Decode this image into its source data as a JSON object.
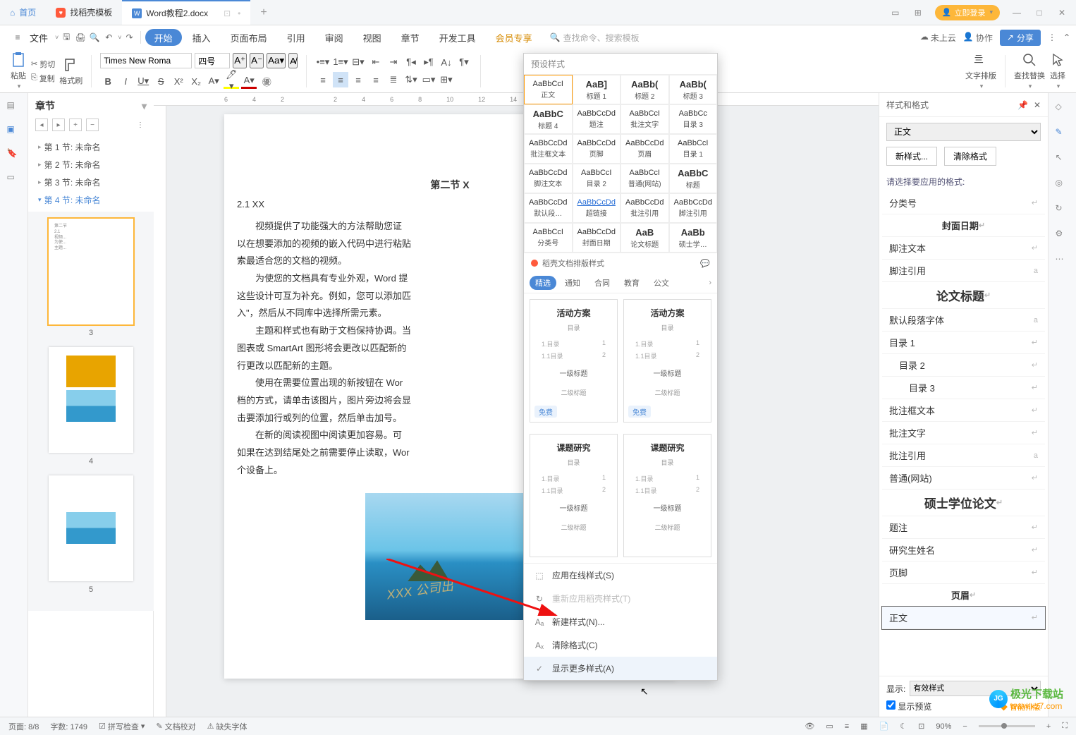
{
  "titlebar": {
    "tabs": [
      {
        "label": "首页",
        "icon": "home"
      },
      {
        "label": "找稻壳模板",
        "icon": "docer"
      },
      {
        "label": "Word教程2.docx",
        "icon": "word",
        "active": true
      }
    ],
    "login": "立即登录"
  },
  "menubar": {
    "file": "文件",
    "tabs": [
      "开始",
      "插入",
      "页面布局",
      "引用",
      "审阅",
      "视图",
      "章节",
      "开发工具",
      "会员专享"
    ],
    "active": "开始",
    "search_placeholder": "查找命令、搜索模板",
    "cloud": "未上云",
    "coop": "协作",
    "share": "分享"
  },
  "ribbon": {
    "paste": "粘贴",
    "cut": "剪切",
    "copy": "复制",
    "format_painter": "格式刷",
    "font_name": "Times New Roma",
    "font_size": "四号",
    "text_layout": "文字排版",
    "find_replace": "查找替换",
    "select": "选择",
    "styles_header": "预设样式"
  },
  "style_grid": [
    {
      "prev": "AaBbCcI",
      "lbl": "正文",
      "sel": true
    },
    {
      "prev": "AaB]",
      "lbl": "标题 1",
      "bold": true
    },
    {
      "prev": "AaBb(",
      "lbl": "标题 2",
      "bold": true
    },
    {
      "prev": "AaBb(",
      "lbl": "标题 3",
      "bold": true
    },
    {
      "prev": "AaBbC",
      "lbl": "标题 4",
      "bold": true
    },
    {
      "prev": "AaBbCcDd",
      "lbl": "题注"
    },
    {
      "prev": "AaBbCcI",
      "lbl": "批注文字"
    },
    {
      "prev": "AaBbCc",
      "lbl": "目录 3"
    },
    {
      "prev": "AaBbCcDd",
      "lbl": "批注框文本"
    },
    {
      "prev": "AaBbCcDd",
      "lbl": "页脚"
    },
    {
      "prev": "AaBbCcDd",
      "lbl": "页眉"
    },
    {
      "prev": "AaBbCcI",
      "lbl": "目录 1"
    },
    {
      "prev": "AaBbCcDd",
      "lbl": "脚注文本"
    },
    {
      "prev": "AaBbCcI",
      "lbl": "目录 2"
    },
    {
      "prev": "AaBbCcI",
      "lbl": "普通(网站)"
    },
    {
      "prev": "AaBbC",
      "lbl": "标题",
      "bold": true
    },
    {
      "prev": "AaBbCcDd",
      "lbl": "默认段…"
    },
    {
      "prev": "AaBbCcDd",
      "lbl": "超链接",
      "link": true
    },
    {
      "prev": "AaBbCcDd",
      "lbl": "批注引用"
    },
    {
      "prev": "AaBbCcDd",
      "lbl": "脚注引用"
    },
    {
      "prev": "AaBbCcI",
      "lbl": "分类号"
    },
    {
      "prev": "AaBbCcDd",
      "lbl": "封面日期"
    },
    {
      "prev": "AaB",
      "lbl": "论文标题",
      "bold": true
    },
    {
      "prev": "AaBb",
      "lbl": "硕士学…",
      "bold": true
    }
  ],
  "docer_head": "稻壳文档排版样式",
  "docer_tabs": [
    "精选",
    "通知",
    "合同",
    "教育",
    "公文"
  ],
  "templates": [
    {
      "title": "活动方案",
      "sub": "目录",
      "lines": [
        [
          "1.目录",
          "1"
        ],
        [
          "1.1目录",
          "2"
        ]
      ],
      "h1": "一级标题",
      "h2": "二级标题",
      "free": "免费"
    },
    {
      "title": "活动方案",
      "sub": "目录",
      "lines": [
        [
          "1.目录",
          "1"
        ],
        [
          "1.1目录",
          "2"
        ]
      ],
      "h1": "一级标题",
      "h2": "二级标题",
      "free": "免费"
    },
    {
      "title": "课题研究",
      "sub": "目录",
      "lines": [
        [
          "1.目录",
          "1"
        ],
        [
          "1.1目录",
          "2"
        ]
      ],
      "h1": "一级标题",
      "h2": "二级标题"
    },
    {
      "title": "课题研究",
      "sub": "目录",
      "lines": [
        [
          "1.目录",
          "1"
        ],
        [
          "1.1目录",
          "2"
        ]
      ],
      "h1": "一级标题",
      "h2": "二级标题"
    }
  ],
  "style_menu": [
    {
      "icon": "⬚",
      "label": "应用在线样式(S)"
    },
    {
      "icon": "↻",
      "label": "重新应用稻壳样式(T)",
      "disabled": true
    },
    {
      "icon": "Aₐ",
      "label": "新建样式(N)..."
    },
    {
      "icon": "Aₓ",
      "label": "清除格式(C)"
    },
    {
      "icon": "✓",
      "label": "显示更多样式(A)",
      "hov": true
    }
  ],
  "nav": {
    "title": "章节",
    "items": [
      "第 1 节: 未命名",
      "第 2 节: 未命名",
      "第 3 节: 未命名",
      "第 4 节: 未命名"
    ],
    "selected": 3
  },
  "thumbs": [
    "3",
    "4",
    "5"
  ],
  "document": {
    "heading": "第二节  X",
    "sub": "2.1 XX",
    "p1": "视频提供了功能强大的方法帮助您证",
    "p2": "以在想要添加的视频的嵌入代码中进行粘贴",
    "p3": "索最适合您的文档的视频。",
    "p4": "为使您的文档具有专业外观，Word 提",
    "p5": "这些设计可互为补充。例如，您可以添加匹",
    "p6": "入\"，然后从不同库中选择所需元素。",
    "p7": "主题和样式也有助于文档保持协调。当",
    "p8": "图表或 SmartArt 图形将会更改以匹配新的",
    "p9": "行更改以匹配新的主题。",
    "p10": "使用在需要位置出现的新按钮在 Wor",
    "p11": "档的方式，请单击该图片，图片旁边将会显",
    "p12": "击要添加行或列的位置，然后单击加号。",
    "p13": "在新的阅读视图中阅读更加容易。可",
    "p14": "如果在达到结尾处之前需要停止读取，Wor",
    "p15": "个设备上。",
    "watermark": "XXX 公司出"
  },
  "right_panel": {
    "title": "样式和格式",
    "current": "正文",
    "new_style": "新样式...",
    "clear": "清除格式",
    "subhead": "请选择要应用的格式:",
    "items": [
      {
        "txt": "分类号",
        "mk": "↵"
      },
      {
        "txt": "封面日期",
        "mk": "↵",
        "center": true
      },
      {
        "txt": "脚注文本",
        "mk": "↵"
      },
      {
        "txt": "脚注引用",
        "mk": "a"
      },
      {
        "txt": "论文标题",
        "mk": "↵",
        "center": true,
        "big": true
      },
      {
        "txt": "默认段落字体",
        "mk": "a"
      },
      {
        "txt": "目录 1",
        "mk": "↵"
      },
      {
        "txt": "目录 2",
        "mk": "↵",
        "indent": 1
      },
      {
        "txt": "目录 3",
        "mk": "↵",
        "indent": 2
      },
      {
        "txt": "批注框文本",
        "mk": "↵"
      },
      {
        "txt": "批注文字",
        "mk": "↵"
      },
      {
        "txt": "批注引用",
        "mk": "a"
      },
      {
        "txt": "普通(网站)",
        "mk": "↵"
      },
      {
        "txt": "硕士学位论文",
        "mk": "↵",
        "center": true,
        "big": true
      },
      {
        "txt": "题注",
        "mk": "↵"
      },
      {
        "txt": "研究生姓名",
        "mk": "↵"
      },
      {
        "txt": "页脚",
        "mk": "↵"
      },
      {
        "txt": "页眉",
        "mk": "↵",
        "center": true
      },
      {
        "txt": "正文",
        "mk": "↵",
        "sel": true
      }
    ],
    "show_label": "显示:",
    "show_value": "有效样式",
    "preview_chk": "显示预览",
    "smart": "智能排版"
  },
  "statusbar": {
    "page": "页面: 8/8",
    "words": "字数: 1749",
    "spell": "拼写检查",
    "proof": "文档校对",
    "missing": "缺失字体",
    "zoom": "90%"
  },
  "ruler": [
    "6",
    "4",
    "2",
    "",
    "2",
    "4",
    "6",
    "8",
    "10",
    "12",
    "14"
  ],
  "site": {
    "name": "极光下载站",
    "url": "www.xz7.com"
  }
}
